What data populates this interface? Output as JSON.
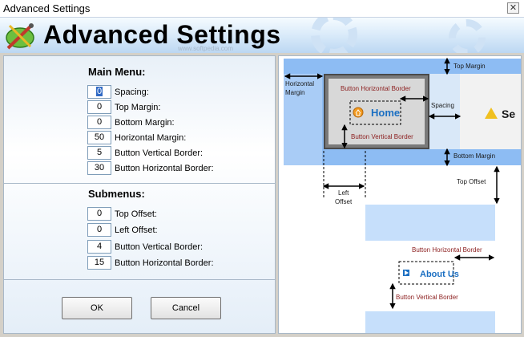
{
  "window": {
    "title": "Advanced Settings",
    "close_glyph": "✕"
  },
  "banner": {
    "heading": "Advanced Settings",
    "watermark": "www.softpedia.com"
  },
  "main_menu": {
    "title": "Main Menu:",
    "fields": [
      {
        "label": "Spacing:",
        "value": "0"
      },
      {
        "label": "Top Margin:",
        "value": "0"
      },
      {
        "label": "Bottom Margin:",
        "value": "0"
      },
      {
        "label": "Horizontal Margin:",
        "value": "50"
      },
      {
        "label": "Button Vertical Border:",
        "value": "5"
      },
      {
        "label": "Button Horizontal Border:",
        "value": "30"
      }
    ]
  },
  "submenus": {
    "title": "Submenus:",
    "fields": [
      {
        "label": "Top Offset:",
        "value": "0"
      },
      {
        "label": "Left Offset:",
        "value": "0"
      },
      {
        "label": "Button Vertical Border:",
        "value": "4"
      },
      {
        "label": "Button Horizontal Border:",
        "value": "15"
      }
    ]
  },
  "buttons": {
    "ok": "OK",
    "cancel": "Cancel"
  },
  "diagram": {
    "top_margin": "Top Margin",
    "horizontal_margin_1": "Horizontal",
    "horizontal_margin_2": "Margin",
    "button_horizontal_border": "Button Horizontal Border",
    "home_label": "Home",
    "spacing": "Spacing",
    "button_vertical_border": "Button Vertical Border",
    "bottom_margin": "Bottom Margin",
    "next_button_partial": "Se",
    "left_offset_1": "Left",
    "left_offset_2": "Offset",
    "top_offset": "Top Offset",
    "sub_button_horizontal_border": "Button Horizontal Border",
    "about_label": "About Us",
    "sub_button_vertical_border": "Button Vertical Border"
  },
  "colors": {
    "menu_bar": "#8dbcf3",
    "submenu_bg": "#c6dffb",
    "label_red": "#8b1d1d",
    "link_blue": "#1b6fc2"
  }
}
